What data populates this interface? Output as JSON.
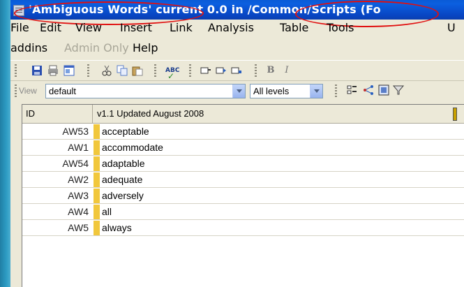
{
  "window": {
    "title": "'Ambiguous Words' current 0.0 in /Common/Scripts (Fo"
  },
  "menubar": {
    "items": [
      "File",
      "Edit",
      "View",
      "Insert",
      "Link",
      "Analysis",
      "Table",
      "Tools",
      "U"
    ],
    "items_row2": [
      "addins",
      "Admin Only",
      "Help"
    ]
  },
  "toolbar": {
    "icons": [
      "save-icon",
      "print-icon",
      "properties-icon",
      "cut-icon",
      "copy-icon",
      "paste-icon",
      "spellcheck-icon",
      "insert-object-icon",
      "insert-after-icon",
      "insert-below-icon",
      "bold-icon",
      "italic-icon"
    ]
  },
  "viewbar": {
    "view_label": "View",
    "view_value": "default",
    "levels_value": "All levels"
  },
  "grid": {
    "columns": [
      "ID",
      "v1.1 Updated August 2008"
    ],
    "rows": [
      {
        "id": "AW53",
        "word": "acceptable"
      },
      {
        "id": "AW1",
        "word": "accommodate"
      },
      {
        "id": "AW54",
        "word": "adaptable"
      },
      {
        "id": "AW2",
        "word": "adequate"
      },
      {
        "id": "AW3",
        "word": "adversely"
      },
      {
        "id": "AW4",
        "word": "all"
      },
      {
        "id": "AW5",
        "word": "always"
      }
    ]
  },
  "colors": {
    "titlebar": "#0a5bd6",
    "highlight_circle": "#e01010",
    "row_marker": "#f1c73c"
  }
}
